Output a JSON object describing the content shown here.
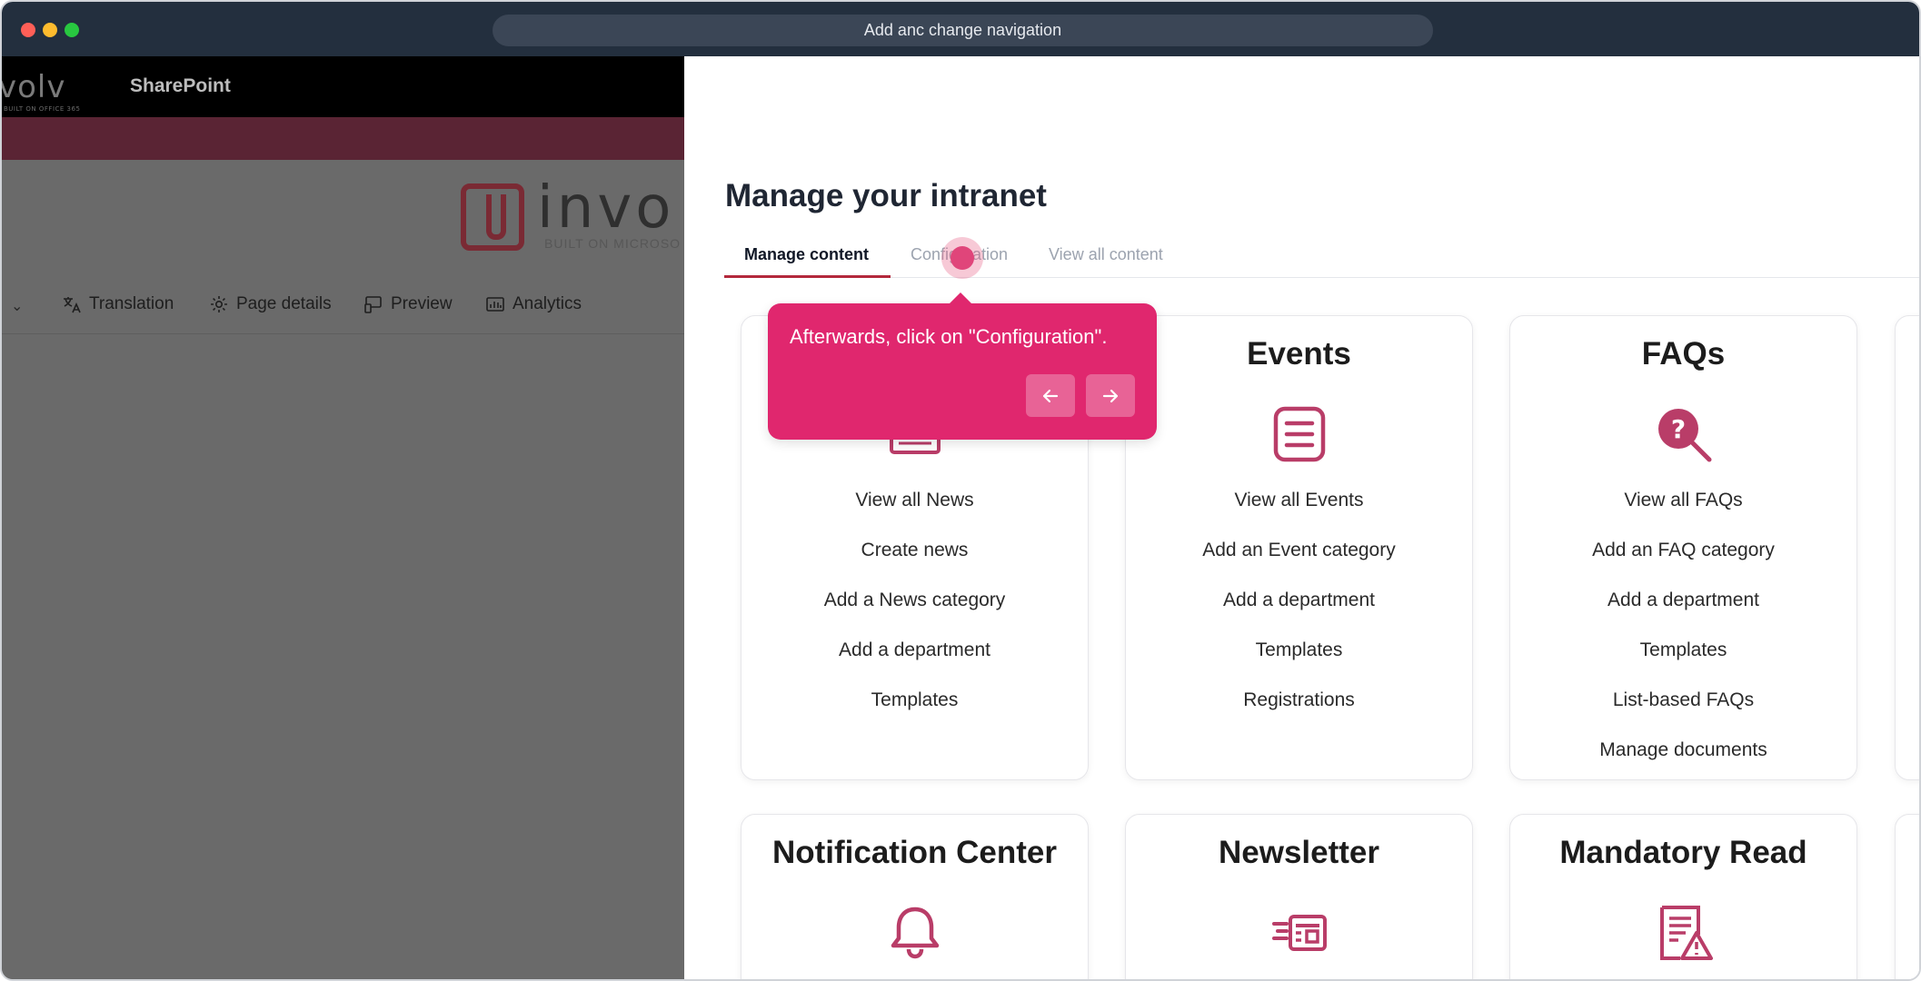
{
  "window": {
    "title": "Add anc change navigation"
  },
  "sharepoint": {
    "logo_text": "volv",
    "logo_small": "BUILT ON OFFICE 365",
    "brand": "SharePoint",
    "site_logo_text": "invo",
    "site_logo_sub": "BUILT ON MICROSO",
    "commands": [
      {
        "label": "Translation",
        "icon": "translation-icon"
      },
      {
        "label": "Page details",
        "icon": "gear-icon"
      },
      {
        "label": "Preview",
        "icon": "preview-icon"
      },
      {
        "label": "Analytics",
        "icon": "analytics-icon"
      }
    ]
  },
  "panel": {
    "title": "Manage your intranet",
    "tabs": [
      {
        "label": "Manage content",
        "active": true
      },
      {
        "label": "Configuration",
        "active": false
      },
      {
        "label": "View all content",
        "active": false
      }
    ],
    "cards": [
      {
        "title": "",
        "icon": "news-icon",
        "links": [
          "View all News",
          "Create news",
          "Add a News category",
          "Add a department",
          "Templates"
        ]
      },
      {
        "title": "Events",
        "icon": "list-icon",
        "links": [
          "View all Events",
          "Add an Event category",
          "Add a department",
          "Templates",
          "Registrations"
        ]
      },
      {
        "title": "FAQs",
        "icon": "question-search-icon",
        "links": [
          "View all FAQs",
          "Add an FAQ category",
          "Add a department",
          "Templates",
          "List-based FAQs",
          "Manage documents"
        ]
      },
      {
        "title": "Notification Center",
        "icon": "bell-icon",
        "links": []
      },
      {
        "title": "Newsletter",
        "icon": "newsletter-icon",
        "links": []
      },
      {
        "title": "Mandatory Read",
        "icon": "document-warning-icon",
        "links": []
      }
    ]
  },
  "tooltip": {
    "text": "Afterwards, click on \"Configuration\".",
    "prev_icon": "arrow-left-icon",
    "next_icon": "arrow-right-icon"
  },
  "colors": {
    "accent": "#e0276e",
    "icon": "#b93d68",
    "titlebar": "#232f3e"
  }
}
